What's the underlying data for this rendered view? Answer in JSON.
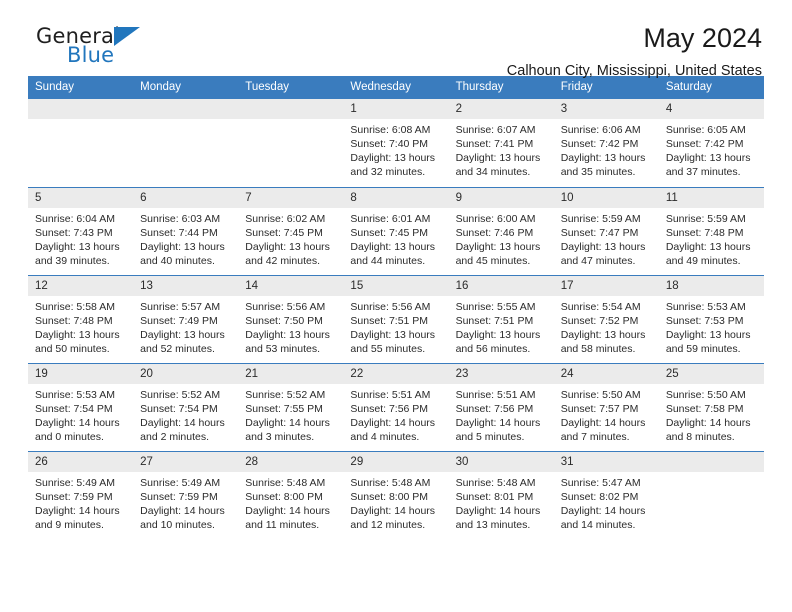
{
  "brand": {
    "name_line1": "General",
    "name_line2": "Blue",
    "triangle_color": "#2176bd",
    "logo_icon": "triangle-icon"
  },
  "header": {
    "title": "May 2024",
    "subtitle": "Calhoun City, Mississippi, United States"
  },
  "theme": {
    "header_bg": "#3a7cbe",
    "daynum_bg": "#ebebeb",
    "row_divider": "#3a7cbe",
    "text": "#2b2b2b"
  },
  "weekdays": [
    {
      "label": "Sunday"
    },
    {
      "label": "Monday"
    },
    {
      "label": "Tuesday"
    },
    {
      "label": "Wednesday"
    },
    {
      "label": "Thursday"
    },
    {
      "label": "Friday"
    },
    {
      "label": "Saturday"
    }
  ],
  "weeks": [
    [
      {
        "day": "",
        "empty": true,
        "sunrise": "",
        "sunset": "",
        "daylight_l1": "",
        "daylight_l2": ""
      },
      {
        "day": "",
        "empty": true,
        "sunrise": "",
        "sunset": "",
        "daylight_l1": "",
        "daylight_l2": ""
      },
      {
        "day": "",
        "empty": true,
        "sunrise": "",
        "sunset": "",
        "daylight_l1": "",
        "daylight_l2": ""
      },
      {
        "day": "1",
        "sunrise": "Sunrise: 6:08 AM",
        "sunset": "Sunset: 7:40 PM",
        "daylight_l1": "Daylight: 13 hours",
        "daylight_l2": "and 32 minutes."
      },
      {
        "day": "2",
        "sunrise": "Sunrise: 6:07 AM",
        "sunset": "Sunset: 7:41 PM",
        "daylight_l1": "Daylight: 13 hours",
        "daylight_l2": "and 34 minutes."
      },
      {
        "day": "3",
        "sunrise": "Sunrise: 6:06 AM",
        "sunset": "Sunset: 7:42 PM",
        "daylight_l1": "Daylight: 13 hours",
        "daylight_l2": "and 35 minutes."
      },
      {
        "day": "4",
        "sunrise": "Sunrise: 6:05 AM",
        "sunset": "Sunset: 7:42 PM",
        "daylight_l1": "Daylight: 13 hours",
        "daylight_l2": "and 37 minutes."
      }
    ],
    [
      {
        "day": "5",
        "sunrise": "Sunrise: 6:04 AM",
        "sunset": "Sunset: 7:43 PM",
        "daylight_l1": "Daylight: 13 hours",
        "daylight_l2": "and 39 minutes."
      },
      {
        "day": "6",
        "sunrise": "Sunrise: 6:03 AM",
        "sunset": "Sunset: 7:44 PM",
        "daylight_l1": "Daylight: 13 hours",
        "daylight_l2": "and 40 minutes."
      },
      {
        "day": "7",
        "sunrise": "Sunrise: 6:02 AM",
        "sunset": "Sunset: 7:45 PM",
        "daylight_l1": "Daylight: 13 hours",
        "daylight_l2": "and 42 minutes."
      },
      {
        "day": "8",
        "sunrise": "Sunrise: 6:01 AM",
        "sunset": "Sunset: 7:45 PM",
        "daylight_l1": "Daylight: 13 hours",
        "daylight_l2": "and 44 minutes."
      },
      {
        "day": "9",
        "sunrise": "Sunrise: 6:00 AM",
        "sunset": "Sunset: 7:46 PM",
        "daylight_l1": "Daylight: 13 hours",
        "daylight_l2": "and 45 minutes."
      },
      {
        "day": "10",
        "sunrise": "Sunrise: 5:59 AM",
        "sunset": "Sunset: 7:47 PM",
        "daylight_l1": "Daylight: 13 hours",
        "daylight_l2": "and 47 minutes."
      },
      {
        "day": "11",
        "sunrise": "Sunrise: 5:59 AM",
        "sunset": "Sunset: 7:48 PM",
        "daylight_l1": "Daylight: 13 hours",
        "daylight_l2": "and 49 minutes."
      }
    ],
    [
      {
        "day": "12",
        "sunrise": "Sunrise: 5:58 AM",
        "sunset": "Sunset: 7:48 PM",
        "daylight_l1": "Daylight: 13 hours",
        "daylight_l2": "and 50 minutes."
      },
      {
        "day": "13",
        "sunrise": "Sunrise: 5:57 AM",
        "sunset": "Sunset: 7:49 PM",
        "daylight_l1": "Daylight: 13 hours",
        "daylight_l2": "and 52 minutes."
      },
      {
        "day": "14",
        "sunrise": "Sunrise: 5:56 AM",
        "sunset": "Sunset: 7:50 PM",
        "daylight_l1": "Daylight: 13 hours",
        "daylight_l2": "and 53 minutes."
      },
      {
        "day": "15",
        "sunrise": "Sunrise: 5:56 AM",
        "sunset": "Sunset: 7:51 PM",
        "daylight_l1": "Daylight: 13 hours",
        "daylight_l2": "and 55 minutes."
      },
      {
        "day": "16",
        "sunrise": "Sunrise: 5:55 AM",
        "sunset": "Sunset: 7:51 PM",
        "daylight_l1": "Daylight: 13 hours",
        "daylight_l2": "and 56 minutes."
      },
      {
        "day": "17",
        "sunrise": "Sunrise: 5:54 AM",
        "sunset": "Sunset: 7:52 PM",
        "daylight_l1": "Daylight: 13 hours",
        "daylight_l2": "and 58 minutes."
      },
      {
        "day": "18",
        "sunrise": "Sunrise: 5:53 AM",
        "sunset": "Sunset: 7:53 PM",
        "daylight_l1": "Daylight: 13 hours",
        "daylight_l2": "and 59 minutes."
      }
    ],
    [
      {
        "day": "19",
        "sunrise": "Sunrise: 5:53 AM",
        "sunset": "Sunset: 7:54 PM",
        "daylight_l1": "Daylight: 14 hours",
        "daylight_l2": "and 0 minutes."
      },
      {
        "day": "20",
        "sunrise": "Sunrise: 5:52 AM",
        "sunset": "Sunset: 7:54 PM",
        "daylight_l1": "Daylight: 14 hours",
        "daylight_l2": "and 2 minutes."
      },
      {
        "day": "21",
        "sunrise": "Sunrise: 5:52 AM",
        "sunset": "Sunset: 7:55 PM",
        "daylight_l1": "Daylight: 14 hours",
        "daylight_l2": "and 3 minutes."
      },
      {
        "day": "22",
        "sunrise": "Sunrise: 5:51 AM",
        "sunset": "Sunset: 7:56 PM",
        "daylight_l1": "Daylight: 14 hours",
        "daylight_l2": "and 4 minutes."
      },
      {
        "day": "23",
        "sunrise": "Sunrise: 5:51 AM",
        "sunset": "Sunset: 7:56 PM",
        "daylight_l1": "Daylight: 14 hours",
        "daylight_l2": "and 5 minutes."
      },
      {
        "day": "24",
        "sunrise": "Sunrise: 5:50 AM",
        "sunset": "Sunset: 7:57 PM",
        "daylight_l1": "Daylight: 14 hours",
        "daylight_l2": "and 7 minutes."
      },
      {
        "day": "25",
        "sunrise": "Sunrise: 5:50 AM",
        "sunset": "Sunset: 7:58 PM",
        "daylight_l1": "Daylight: 14 hours",
        "daylight_l2": "and 8 minutes."
      }
    ],
    [
      {
        "day": "26",
        "sunrise": "Sunrise: 5:49 AM",
        "sunset": "Sunset: 7:59 PM",
        "daylight_l1": "Daylight: 14 hours",
        "daylight_l2": "and 9 minutes."
      },
      {
        "day": "27",
        "sunrise": "Sunrise: 5:49 AM",
        "sunset": "Sunset: 7:59 PM",
        "daylight_l1": "Daylight: 14 hours",
        "daylight_l2": "and 10 minutes."
      },
      {
        "day": "28",
        "sunrise": "Sunrise: 5:48 AM",
        "sunset": "Sunset: 8:00 PM",
        "daylight_l1": "Daylight: 14 hours",
        "daylight_l2": "and 11 minutes."
      },
      {
        "day": "29",
        "sunrise": "Sunrise: 5:48 AM",
        "sunset": "Sunset: 8:00 PM",
        "daylight_l1": "Daylight: 14 hours",
        "daylight_l2": "and 12 minutes."
      },
      {
        "day": "30",
        "sunrise": "Sunrise: 5:48 AM",
        "sunset": "Sunset: 8:01 PM",
        "daylight_l1": "Daylight: 14 hours",
        "daylight_l2": "and 13 minutes."
      },
      {
        "day": "31",
        "sunrise": "Sunrise: 5:47 AM",
        "sunset": "Sunset: 8:02 PM",
        "daylight_l1": "Daylight: 14 hours",
        "daylight_l2": "and 14 minutes."
      },
      {
        "day": "",
        "empty": true,
        "sunrise": "",
        "sunset": "",
        "daylight_l1": "",
        "daylight_l2": ""
      }
    ]
  ]
}
